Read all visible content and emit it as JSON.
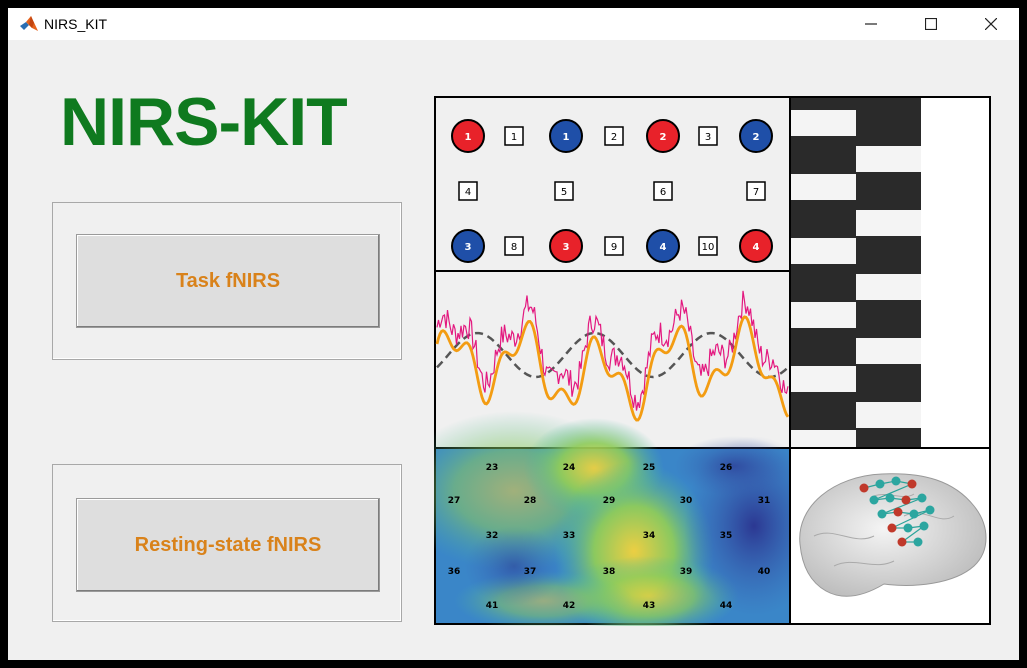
{
  "window": {
    "title": "NIRS_KIT",
    "controls": [
      "minimize-icon",
      "maximize-icon",
      "close-icon"
    ]
  },
  "logo": {
    "text": "NIRS-KIT",
    "color": "#0f7a1f"
  },
  "buttons": {
    "task": "Task fNIRS",
    "resting": "Resting-state fNIRS",
    "color": "#d9821a"
  },
  "probe": {
    "top_row": [
      "1",
      "1",
      "1",
      "2",
      "2",
      "3",
      "2"
    ],
    "top_types": [
      "S",
      "C",
      "D",
      "C",
      "S",
      "C",
      "D"
    ],
    "middle_row": [
      "4",
      "5",
      "6",
      "7"
    ],
    "bottom_row": [
      "3",
      "8",
      "3",
      "9",
      "4",
      "10",
      "4"
    ],
    "bottom_types": [
      "D",
      "C",
      "S",
      "C",
      "D",
      "C",
      "S"
    ],
    "source_color": "#e8222a",
    "detector_color": "#1f4fa8"
  },
  "topomap": {
    "rows": [
      [
        "23",
        "24",
        "25",
        "26"
      ],
      [
        "27",
        "28",
        "29",
        "30",
        "31"
      ],
      [
        "32",
        "33",
        "34",
        "35"
      ],
      [
        "36",
        "37",
        "38",
        "39",
        "40"
      ],
      [
        "41",
        "42",
        "43",
        "44"
      ]
    ]
  }
}
